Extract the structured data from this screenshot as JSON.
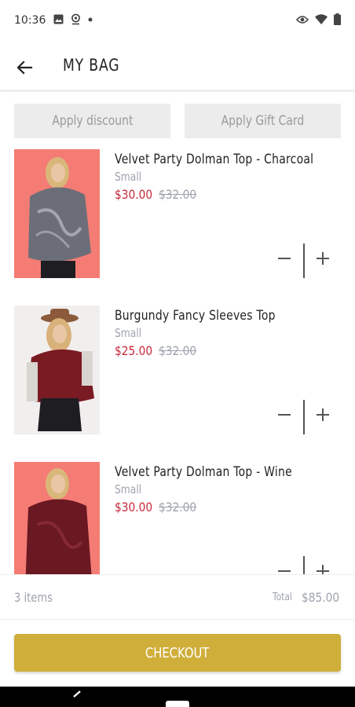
{
  "status_bar": {
    "time": "10:36",
    "icons_left": [
      "image-icon",
      "location-pin-icon",
      "dot-icon"
    ],
    "icons_right": [
      "eye-icon",
      "wifi-icon",
      "battery-icon"
    ]
  },
  "app_bar": {
    "title": "MY BAG",
    "back_icon": "arrow-left-icon"
  },
  "actions": {
    "apply_discount_label": "Apply discount",
    "apply_gift_card_label": "Apply Gift Card"
  },
  "items": [
    {
      "name": "Velvet Party Dolman Top - Charcoal",
      "size": "Small",
      "sale_price": "$30.00",
      "original_price": "$32.00",
      "image_background": "#f47c74",
      "garment_color": "#6b6e78"
    },
    {
      "name": "Burgundy Fancy Sleeves Top",
      "size": "Small",
      "sale_price": "$25.00",
      "original_price": "$32.00",
      "image_background": "#f1eeee",
      "garment_color": "#7a1a22"
    },
    {
      "name": "Velvet Party Dolman Top - Wine",
      "size": "Small",
      "sale_price": "$30.00",
      "original_price": "$32.00",
      "image_background": "#f47c74",
      "garment_color": "#6a1822"
    }
  ],
  "summary": {
    "items_count": "3 items",
    "total_label": "Total",
    "total_value": "$85.00"
  },
  "checkout": {
    "label": "CHECKOUT",
    "color": "#cfae3a"
  },
  "colors": {
    "sale_price": "#c8293a",
    "muted_text": "#9ea3ad"
  }
}
